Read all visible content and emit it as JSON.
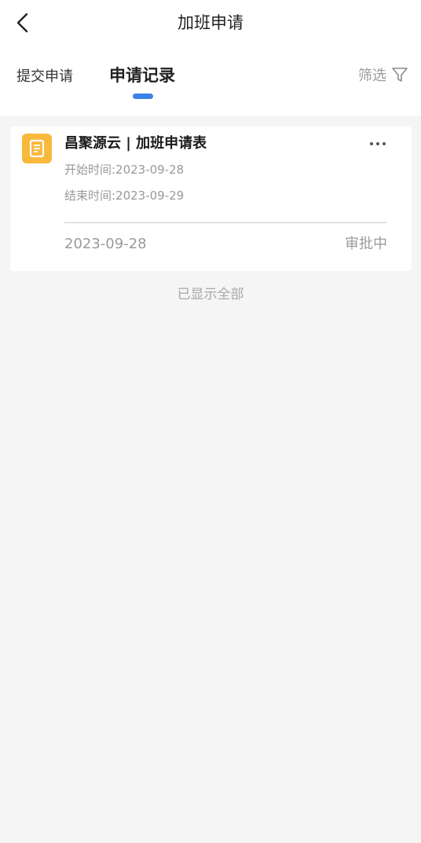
{
  "nav": {
    "title": "加班申请",
    "back_icon": "chevron-left-icon"
  },
  "tabs": [
    {
      "label": "提交申请",
      "active": false
    },
    {
      "label": "申请记录",
      "active": true
    }
  ],
  "filter": {
    "label": "筛选",
    "icon": "filter-funnel-icon"
  },
  "colors": {
    "accent": "#3b82e6",
    "doc_icon_bg": "#f8b93d",
    "page_bg": "#f5f5f5"
  },
  "records": [
    {
      "icon": "document-icon",
      "title": "昌聚源云 | 加班申请表",
      "start_time": "开始时间:2023-09-28",
      "end_time": "结束时间:2023-09-29",
      "date": "2023-09-28",
      "status": "审批中",
      "more_icon": "more-horizontal-icon"
    }
  ],
  "list_end_text": "已显示全部"
}
